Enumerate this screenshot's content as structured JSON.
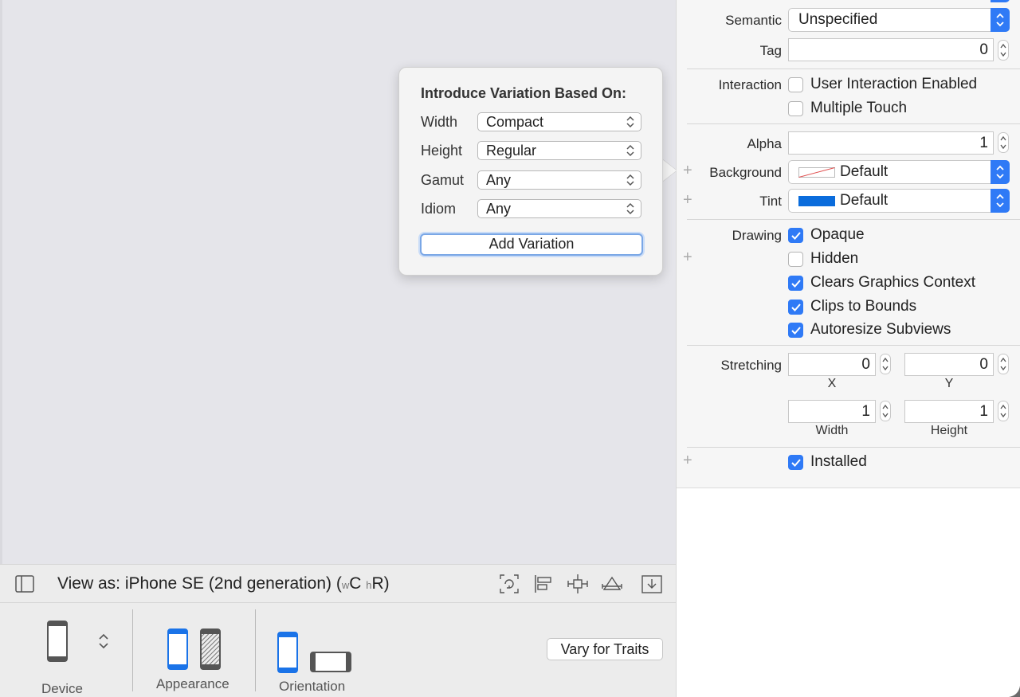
{
  "popover": {
    "title": "Introduce Variation Based On:",
    "rows": [
      {
        "label": "Width",
        "value": "Compact"
      },
      {
        "label": "Height",
        "value": "Regular"
      },
      {
        "label": "Gamut",
        "value": "Any"
      },
      {
        "label": "Idiom",
        "value": "Any"
      }
    ],
    "button": "Add Variation"
  },
  "view_bar": {
    "view_as_prefix": "View as: iPhone SE (2nd generation) (",
    "w_sub": "w",
    "w_val": "C",
    "h_sub": "h",
    "h_val": "R",
    "suffix": ")"
  },
  "device_config": {
    "device_label": "Device",
    "appearance_label": "Appearance",
    "orientation_label": "Orientation",
    "vary_button": "Vary for Traits"
  },
  "inspector": {
    "semantic": {
      "label": "Semantic",
      "value": "Unspecified"
    },
    "tag": {
      "label": "Tag",
      "value": "0"
    },
    "interaction": {
      "label": "Interaction",
      "user_interaction": {
        "label": "User Interaction Enabled",
        "checked": false
      },
      "multiple_touch": {
        "label": "Multiple Touch",
        "checked": false
      }
    },
    "alpha": {
      "label": "Alpha",
      "value": "1"
    },
    "background": {
      "label": "Background",
      "value": "Default"
    },
    "tint": {
      "label": "Tint",
      "value": "Default",
      "color": "#0a6cdc"
    },
    "drawing": {
      "label": "Drawing",
      "opaque": {
        "label": "Opaque",
        "checked": true
      },
      "hidden": {
        "label": "Hidden",
        "checked": false
      },
      "clears": {
        "label": "Clears Graphics Context",
        "checked": true
      },
      "clips": {
        "label": "Clips to Bounds",
        "checked": true
      },
      "autoresize": {
        "label": "Autoresize Subviews",
        "checked": true
      }
    },
    "stretching": {
      "label": "Stretching",
      "x": {
        "value": "0",
        "caption": "X"
      },
      "y": {
        "value": "0",
        "caption": "Y"
      },
      "width": {
        "value": "1",
        "caption": "Width"
      },
      "height": {
        "value": "1",
        "caption": "Height"
      }
    },
    "installed": {
      "label": "Installed",
      "checked": true
    }
  },
  "colors": {
    "accent": "#2f7af6"
  }
}
